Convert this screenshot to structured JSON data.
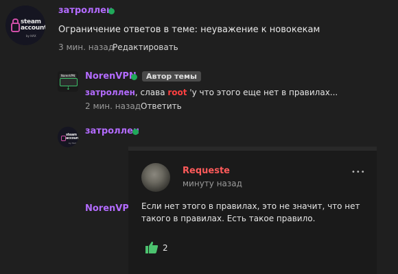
{
  "post1": {
    "author": "затроллен",
    "avatar_text": [
      "steam",
      "accounts"
    ],
    "avatar_small": "by HAX",
    "message": "Ограничение ответов в теме: неуважение к новокекам",
    "time": "3 мин. назад",
    "edit_label": "Редактировать"
  },
  "post2": {
    "author": "NorenVPN",
    "badge": "Автор темы",
    "avatar_text": "NorenVPN",
    "mention": "затроллен",
    "text_a": ", слава ",
    "mention2": "root",
    "text_b": " 'у что этого еще нет в правилах...",
    "time": "2 мин. назад",
    "reply_label": "Ответить"
  },
  "post3": {
    "author": "затроллен",
    "avatar_text": [
      "steam",
      "accounts"
    ],
    "avatar_small": "by HAX",
    "mention": "NorenVPN,",
    "quote": {
      "author": "Requeste",
      "time": "минуту назад",
      "text_line1": "Если нет этого в правилах, это не значит, что нет",
      "text_line2": "такого в правилах. Есть такое правило.",
      "likes": "2",
      "more": "•••"
    }
  },
  "colors": {
    "accent": "#b36bff",
    "online": "#20a95a",
    "mention": "#ff4040"
  },
  "icons": [
    "lock-icon",
    "online-dot-icon",
    "more-icon",
    "thumbs-up-icon",
    "download-arrow-icon"
  ]
}
